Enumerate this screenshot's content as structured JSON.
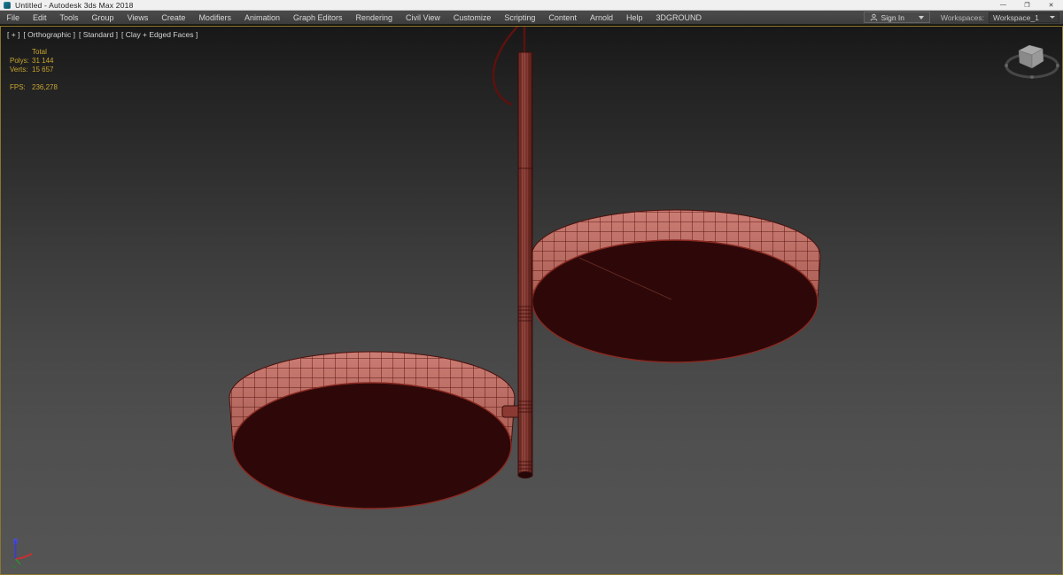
{
  "window": {
    "title": "Untitled - Autodesk 3ds Max 2018",
    "controls": {
      "minimize": "—",
      "restore": "❐",
      "close": "✕"
    }
  },
  "menu_bar": {
    "items": [
      "File",
      "Edit",
      "Tools",
      "Group",
      "Views",
      "Create",
      "Modifiers",
      "Animation",
      "Graph Editors",
      "Rendering",
      "Civil View",
      "Customize",
      "Scripting",
      "Content",
      "Arnold",
      "Help",
      "3DGROUND"
    ],
    "sign_in_label": "Sign In",
    "workspaces_label": "Workspaces:",
    "workspace_value": "Workspace_1"
  },
  "viewport": {
    "label_segments": [
      "[ + ]",
      "[ Orthographic ]",
      "[ Standard ]",
      "[ Clay + Edged Faces ]"
    ],
    "stats": {
      "total_header": "Total",
      "rows": [
        {
          "label": "Polys:",
          "value": "31 144"
        },
        {
          "label": "Verts:",
          "value": "15 657"
        }
      ],
      "fps_label": "FPS:",
      "fps_value": "236,278"
    },
    "colors": {
      "active_border": "#8f7b2e",
      "stats_text": "#c9a52f",
      "background_top": "#1a1a1a",
      "background_bottom": "#565656",
      "disc_rim": "#c27168",
      "disc_face": "#2e0808",
      "disc_edge_red": "#8a2a22",
      "wireframe_dark": "#4a100c",
      "rod_body": "#8a3f38"
    }
  }
}
